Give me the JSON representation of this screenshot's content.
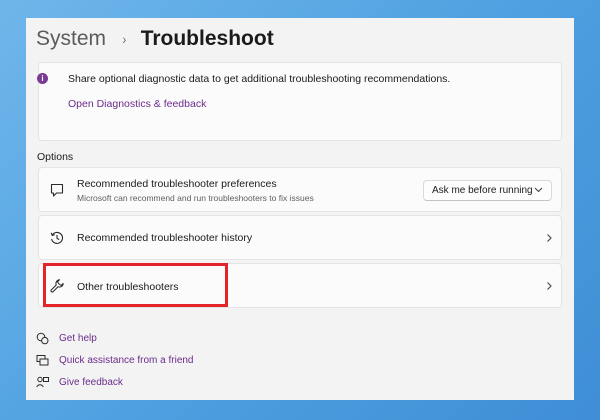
{
  "breadcrumb": {
    "parent": "System",
    "separator": "›",
    "current": "Troubleshoot"
  },
  "info": {
    "icon": "info-icon",
    "text": "Share optional diagnostic data to get additional troubleshooting recommendations.",
    "link": "Open Diagnostics & feedback"
  },
  "options": {
    "title": "Options",
    "rows": [
      {
        "icon": "chat-bubble-icon",
        "title": "Recommended troubleshooter preferences",
        "subtitle": "Microsoft can recommend and run troubleshooters to fix issues",
        "control": {
          "type": "dropdown",
          "selected": "Ask me before running"
        }
      },
      {
        "icon": "history-icon",
        "title": "Recommended troubleshooter history",
        "control": {
          "type": "chevron"
        }
      },
      {
        "icon": "wrench-icon",
        "title": "Other troubleshooters",
        "control": {
          "type": "chevron"
        },
        "highlighted": true
      }
    ]
  },
  "footer_links": [
    {
      "icon": "help-icon",
      "label": "Get help"
    },
    {
      "icon": "quick-assist-icon",
      "label": "Quick assistance from a friend"
    },
    {
      "icon": "feedback-icon",
      "label": "Give feedback"
    }
  ],
  "colors": {
    "accent_link": "#6b2c8a",
    "highlight_border": "#e3242b",
    "background": "#4d9fe0"
  }
}
